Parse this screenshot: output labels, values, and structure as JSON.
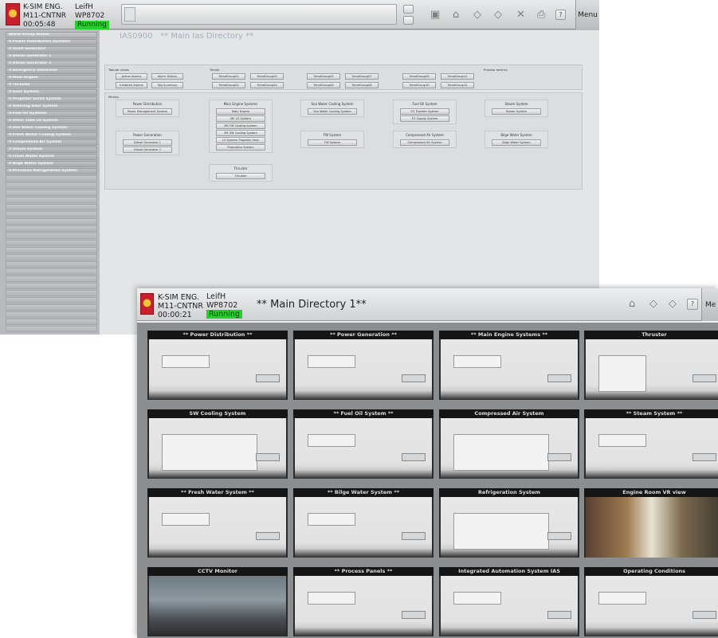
{
  "back_window": {
    "header": {
      "app": "K-SIM ENG.",
      "station": "M11-CNTNR",
      "time": "00:05:48",
      "user": "LeifH",
      "node": "WP8702",
      "status": "Running",
      "menu_label": "Menu",
      "help_label": "?"
    },
    "sidebar": {
      "items": [
        "Alarm Group States",
        "0 Power Distribution Systems",
        "0 Shaft Generator",
        "0 Diesel Generator 1",
        "0 Diesel Generator 2",
        "0 Emergency Generator",
        "0 Main Engine",
        "0 Thruster",
        "0 Gear System",
        "0 Propeller Servo System",
        "0 Steering Gear System",
        "0 Fuel Oil Systems",
        "0 Stern Tube LO System",
        "0 Sea Water Cooling System",
        "0 Fresh Water Cooling System",
        "0 Compressed Air System",
        "0 Steam System",
        "0 Fresh Water System",
        "0 Bilge Water System",
        "0 Provision Refrigeration System"
      ]
    },
    "page": {
      "code": "IAS0900",
      "title": "** Main Ias Directory **"
    },
    "tabular": {
      "label": "Tabular views",
      "buttons": [
        "Active Alarms",
        "Alarm History",
        "Inhibited Alarms",
        "Tag Summary"
      ]
    },
    "trends": {
      "label": "Trends",
      "buttons": [
        "TrendGroup01",
        "TrendGroup03",
        "TrendGroup05",
        "TrendGroup07",
        "TrendGroup09",
        "TrendGroup11",
        "TrendGroup02",
        "TrendGroup04",
        "TrendGroup06",
        "TrendGroup08",
        "TrendGroup10",
        "TrendGroup12"
      ]
    },
    "process_metrics": {
      "label": "Process metrics"
    },
    "mimics": {
      "label": "Mimics",
      "groups": [
        {
          "title": "Power Distribution",
          "buttons": [
            "Power Management System"
          ]
        },
        {
          "title": "Power Generation",
          "buttons": [
            "Diesel Generator 1",
            "Diesel Generator 2"
          ]
        },
        {
          "title": "Main Engine Systems",
          "buttons": [
            "Main Engine",
            "ME LO System",
            "ME FW Cooling System",
            "ME SW Cooling System",
            "LO System Propeller Gear",
            "Propulsion System"
          ]
        },
        {
          "title": "Thruster",
          "buttons": [
            "Thruster"
          ]
        },
        {
          "title": "Sea Water Cooling System",
          "buttons": [
            "Sea Water Cooling System"
          ]
        },
        {
          "title": "FW System",
          "buttons": [
            "FW System"
          ]
        },
        {
          "title": "Fuel Oil System",
          "buttons": [
            "FO Transfer System",
            "FO Supply System"
          ]
        },
        {
          "title": "Compressed Air System",
          "buttons": [
            "Compressed Air System"
          ]
        },
        {
          "title": "Steam System",
          "buttons": [
            "Steam System"
          ]
        },
        {
          "title": "Bilge Water System",
          "buttons": [
            "Bilge Water System"
          ]
        }
      ]
    }
  },
  "front_window": {
    "header": {
      "app": "K-SIM ENG.",
      "station": "M11-CNTNR",
      "time": "00:00:21",
      "user": "LeifH",
      "node": "WP8702",
      "status": "Running",
      "title": "** Main Directory 1**",
      "menu_label": "Me",
      "help_label": "?"
    },
    "tiles": [
      "** Power Distribution **",
      "** Power Generation **",
      "** Main Engine Systems **",
      "Thruster",
      "SW Cooling System",
      "** Fuel Oil System **",
      "Compressed Air System",
      "** Steam System **",
      "** Fresh Water System **",
      "** Bilge Water System **",
      "Refrigeration System",
      "Engine Room VR view",
      "CCTV Monitor",
      "** Process Panels **",
      "Integrated Automation System IAS",
      "Operating Conditions"
    ]
  },
  "colors": {
    "running": "#23d12b",
    "logo": "#c8202f",
    "page_title": "#a2b1c2"
  }
}
